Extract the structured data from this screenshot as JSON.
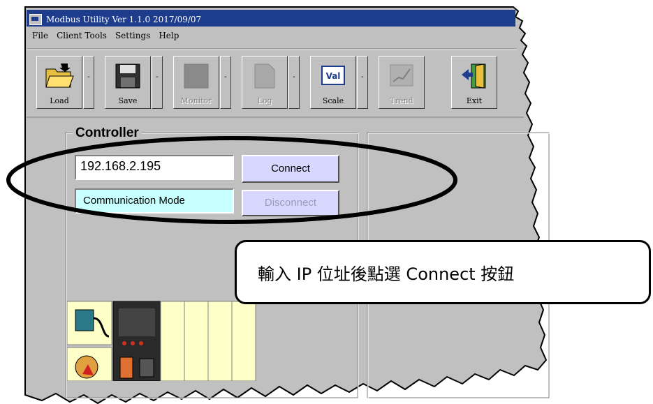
{
  "window": {
    "title": "Modbus Utility   Ver 1.1.0   2017/09/07",
    "menu": [
      "File",
      "Client Tools",
      "Settings",
      "Help"
    ]
  },
  "toolbar": {
    "buttons": [
      {
        "label": "Load",
        "icon": "folder-open-icon",
        "enabled": true
      },
      {
        "label": "Save",
        "icon": "floppy-disk-icon",
        "enabled": true
      },
      {
        "label": "Monitor",
        "icon": "monitor-icon",
        "enabled": false
      },
      {
        "label": "Log",
        "icon": "document-icon",
        "enabled": false
      },
      {
        "label": "Scale",
        "icon": "val-scale-icon",
        "enabled": true
      },
      {
        "label": "Trend",
        "icon": "trend-chart-icon",
        "enabled": false
      },
      {
        "label": "Exit",
        "icon": "exit-door-icon",
        "enabled": true
      }
    ],
    "dropdown_glyph": "-"
  },
  "controller": {
    "group_title": "Controller",
    "ip_value": "192.168.2.195",
    "connect_label": "Connect",
    "mode_label": "Communication Mode",
    "disconnect_label": "Disconnect"
  },
  "callout": {
    "text": "輸入 IP 位址後點選 Connect 按鈕"
  },
  "colors": {
    "title_bar": "#1e3c8c",
    "window_face": "#c0c0c0",
    "button_face": "#d8d8ff",
    "mode_box": "#c8ffff",
    "module_slot": "#ffffc8"
  }
}
